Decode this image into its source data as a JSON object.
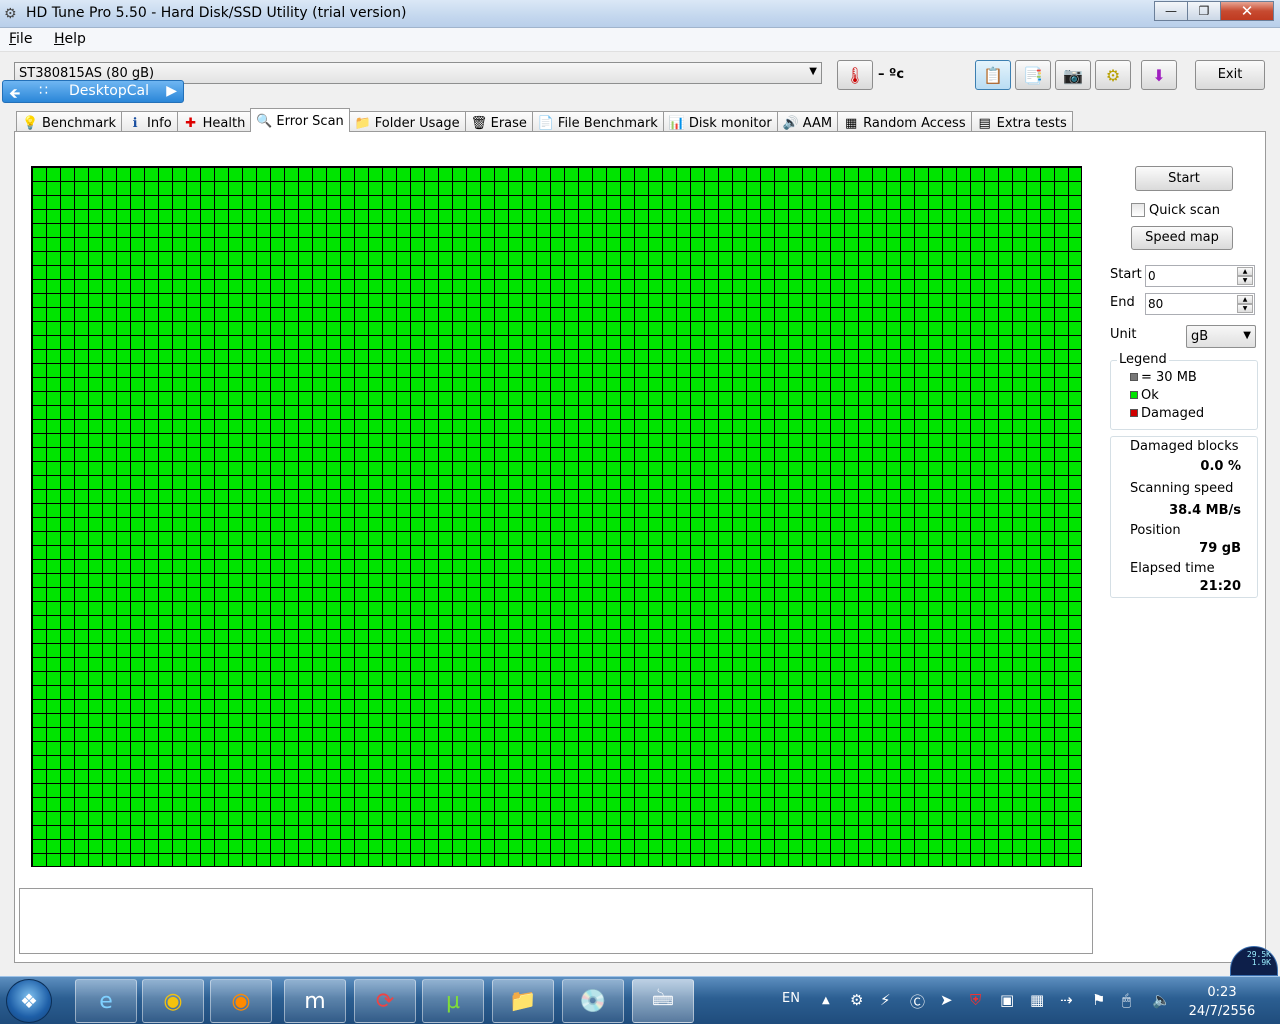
{
  "window": {
    "title": "HD Tune Pro 5.50 - Hard Disk/SSD Utility (trial version)",
    "minimize": "—",
    "maximize": "❐",
    "close": "✕"
  },
  "menu": {
    "file_u": "F",
    "file_rest": "ile",
    "help_u": "H",
    "help_rest": "elp"
  },
  "toolbar": {
    "drive": "ST380815AS (80 gB)",
    "desktopcal": "DesktopCal",
    "temperature": "– ºc",
    "exit_label": "Exit"
  },
  "tabs": [
    {
      "label": "Benchmark",
      "icon": "💡"
    },
    {
      "label": "Info",
      "icon": "ℹ"
    },
    {
      "label": "Health",
      "icon": "✚"
    },
    {
      "label": "Error Scan",
      "icon": "🔍"
    },
    {
      "label": "Folder Usage",
      "icon": "📁"
    },
    {
      "label": "Erase",
      "icon": "🗑"
    },
    {
      "label": "File Benchmark",
      "icon": "📄"
    },
    {
      "label": "Disk monitor",
      "icon": "📊"
    },
    {
      "label": "AAM",
      "icon": "🔊"
    },
    {
      "label": "Random Access",
      "icon": "▦"
    },
    {
      "label": "Extra tests",
      "icon": "▤"
    }
  ],
  "scan": {
    "start_button": "Start",
    "quick_scan": "Quick scan",
    "speed_map": "Speed map",
    "start_label": "Start",
    "start_value": "0",
    "end_label": "End",
    "end_value": "80",
    "unit_label": "Unit",
    "unit_value": "gB"
  },
  "legend": {
    "title": "Legend",
    "block": "= 30 MB",
    "ok": "Ok",
    "damaged": "Damaged",
    "ok_color": "#00e400",
    "damaged_color": "#d00000"
  },
  "stats": {
    "damaged_blocks_label": "Damaged blocks",
    "damaged_blocks_value": "0.0 %",
    "scanning_speed_label": "Scanning speed",
    "scanning_speed_value": "38.4 MB/s",
    "position_label": "Position",
    "position_value": "79 gB",
    "elapsed_label": "Elapsed time",
    "elapsed_value": "21:20"
  },
  "taskbar": {
    "language": "EN",
    "time": "0:23",
    "date": "24/7/2556",
    "net_up": "29.5K",
    "net_down": "1.9K",
    "apps": [
      "internet-explorer",
      "chrome",
      "firefox",
      "maxthon",
      "moto-cafe",
      "utorrent",
      "explorer",
      "disc",
      "hd-tune"
    ]
  }
}
